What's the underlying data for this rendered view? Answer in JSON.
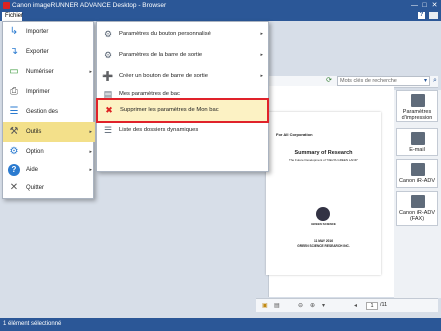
{
  "window": {
    "title": "Canon imageRUNNER ADVANCE Desktop - Browser",
    "min": "—",
    "max": "□",
    "close": "✕"
  },
  "menubar": {
    "fichier": "Fichier",
    "help": "?"
  },
  "file_menu": [
    {
      "label": "Importer",
      "icon": "import-icon",
      "glyph": "↳",
      "arrow": ""
    },
    {
      "label": "Exporter",
      "icon": "export-icon",
      "glyph": "↴",
      "arrow": ""
    },
    {
      "label": "Numériser",
      "icon": "scanner-icon",
      "glyph": "▭",
      "arrow": "▸"
    },
    {
      "label": "Imprimer",
      "icon": "printer-icon",
      "glyph": "⎙",
      "arrow": ""
    },
    {
      "label": "Gestion des bibliothèques",
      "icon": "library-icon",
      "glyph": "☰",
      "arrow": ""
    },
    {
      "label": "Outils",
      "icon": "tools-icon",
      "glyph": "⚒",
      "arrow": "▸"
    },
    {
      "label": "Option",
      "icon": "option-icon",
      "glyph": "⚙",
      "arrow": "▸"
    },
    {
      "label": "Aide",
      "icon": "help-icon",
      "glyph": "?",
      "arrow": "▸"
    },
    {
      "label": "Quitter",
      "icon": "quit-icon",
      "glyph": "✕",
      "arrow": ""
    }
  ],
  "tools_submenu": [
    {
      "label": "Paramètres du bouton personnalisé",
      "icon": "custom-button-settings-icon",
      "glyph": "⚙",
      "arrow": "▸"
    },
    {
      "label": "Paramètres de la barre de sortie",
      "icon": "output-bar-settings-icon",
      "glyph": "⚙",
      "arrow": "▸"
    },
    {
      "label": "Créer un bouton de barre de sortie",
      "icon": "create-output-button-icon",
      "glyph": "➕",
      "arrow": "▸"
    },
    {
      "label": "Mes paramètres de bac",
      "icon": "tray-settings-icon",
      "glyph": "▤",
      "arrow": ""
    },
    {
      "label": "Supprimer les paramètres de Mon bac",
      "icon": "delete-tray-settings-icon",
      "glyph": "✖",
      "arrow": ""
    },
    {
      "label": "Liste des dossiers dynamiques",
      "icon": "dynamic-folder-list-icon",
      "glyph": "☰",
      "arrow": ""
    }
  ],
  "toolbar": {
    "search_placeholder": "Mots clés de recherche"
  },
  "document": {
    "company": "For All Corporation",
    "title": "Summary of Research",
    "subtitle": "The Future Development of \"DELTA GREEN LAND\"",
    "logo_text": "GREEN SCIENCE",
    "date": "11 MAY 2016",
    "publisher": "GREEN SCIENCE RESEARCH INC."
  },
  "output_bar": [
    {
      "label": "Paramètres d'impression",
      "icon": "print-settings-icon"
    },
    {
      "label": "E-mail",
      "icon": "email-icon"
    },
    {
      "label": "Canon iR-ADV",
      "icon": "printer-device-icon"
    },
    {
      "label": "Canon iR-ADV (FAX)",
      "icon": "fax-device-icon"
    }
  ],
  "pager": {
    "current": "1",
    "total": "/11"
  },
  "status": {
    "text": "1 élément sélectionné"
  }
}
